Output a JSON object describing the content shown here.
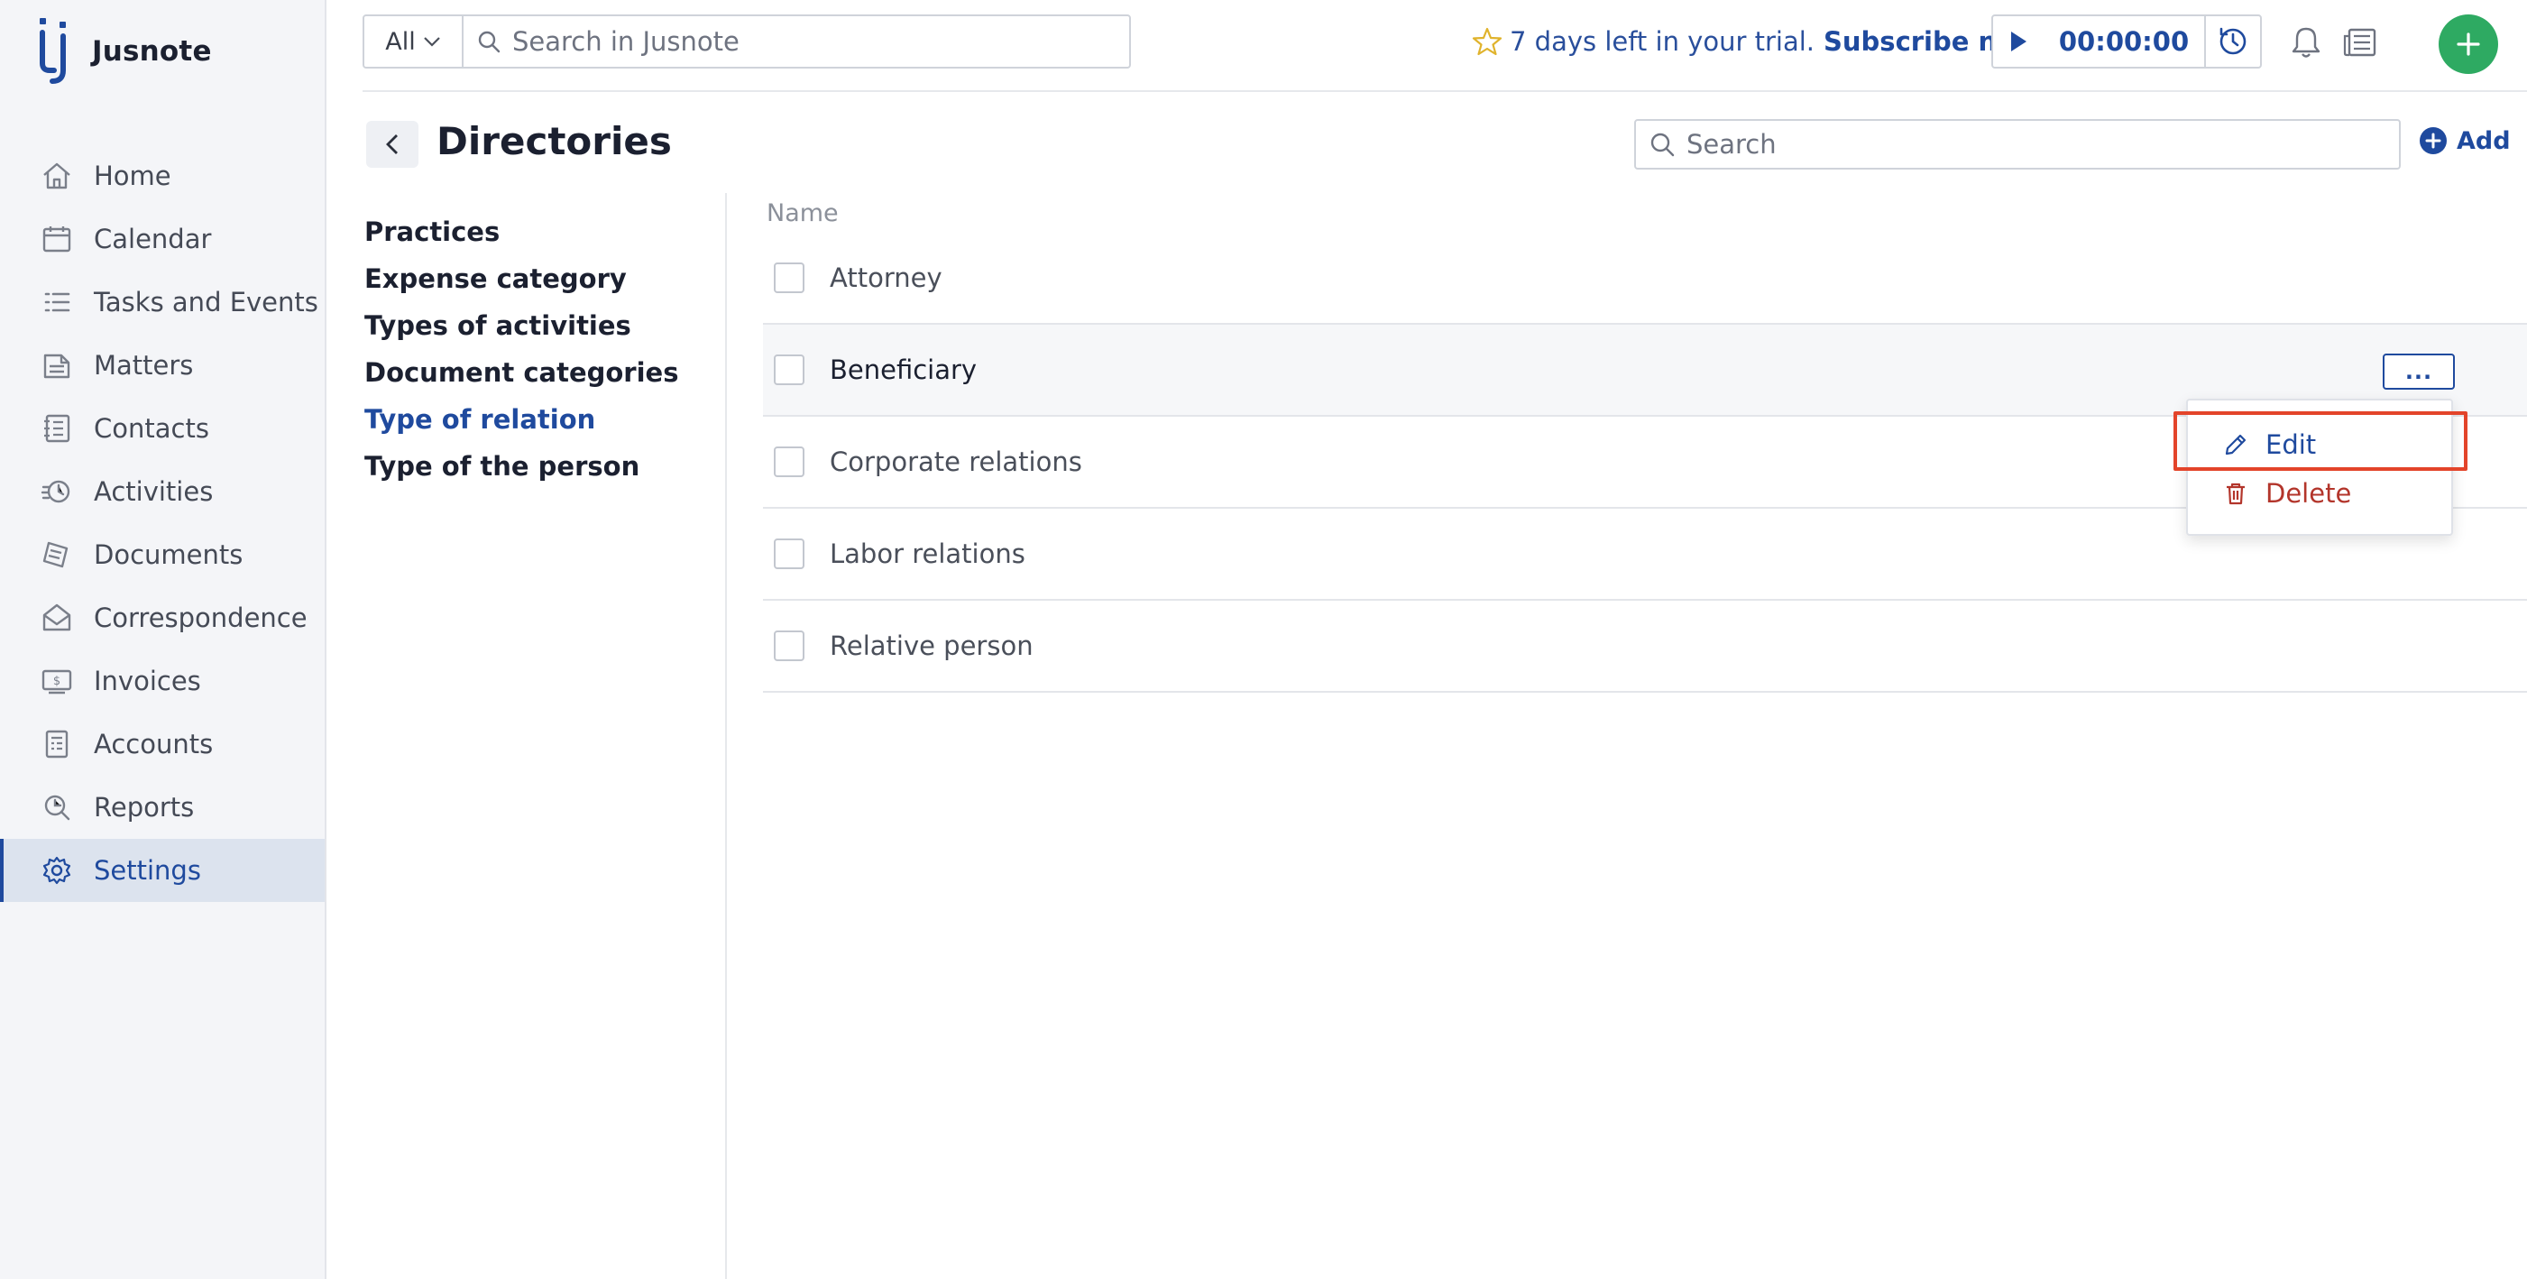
{
  "app": {
    "name": "Jusnote"
  },
  "sidebar": {
    "items": [
      {
        "label": "Home",
        "icon": "home-icon",
        "active": false
      },
      {
        "label": "Calendar",
        "icon": "calendar-icon",
        "active": false
      },
      {
        "label": "Tasks and Events",
        "icon": "tasks-icon",
        "active": false
      },
      {
        "label": "Matters",
        "icon": "matters-icon",
        "active": false
      },
      {
        "label": "Contacts",
        "icon": "contacts-icon",
        "active": false
      },
      {
        "label": "Activities",
        "icon": "activities-icon",
        "active": false
      },
      {
        "label": "Documents",
        "icon": "documents-icon",
        "active": false
      },
      {
        "label": "Correspondence",
        "icon": "correspondence-icon",
        "active": false
      },
      {
        "label": "Invoices",
        "icon": "invoices-icon",
        "active": false
      },
      {
        "label": "Accounts",
        "icon": "accounts-icon",
        "active": false
      },
      {
        "label": "Reports",
        "icon": "reports-icon",
        "active": false
      },
      {
        "label": "Settings",
        "icon": "gear-icon",
        "active": true
      }
    ]
  },
  "header": {
    "scope": "All",
    "search_placeholder": "Search in Jusnote",
    "trial_text": "7 days left in your trial.",
    "subscribe_label": "Subscribe now",
    "timer": "00:00:00"
  },
  "page": {
    "title": "Directories",
    "search_placeholder": "Search",
    "add_label": "Add"
  },
  "directories": [
    {
      "label": "Practices",
      "active": false
    },
    {
      "label": "Expense category",
      "active": false
    },
    {
      "label": "Types of activities",
      "active": false
    },
    {
      "label": "Document categories",
      "active": false
    },
    {
      "label": "Type of relation",
      "active": true
    },
    {
      "label": "Type of the person",
      "active": false
    }
  ],
  "table": {
    "column_name": "Name",
    "rows": [
      {
        "name": "Attorney"
      },
      {
        "name": "Beneficiary"
      },
      {
        "name": "Corporate relations"
      },
      {
        "name": "Labor relations"
      },
      {
        "name": "Relative person"
      }
    ],
    "more_label": "..."
  },
  "context_menu": {
    "edit_label": "Edit",
    "delete_label": "Delete"
  },
  "colors": {
    "accent": "#1f4a9e",
    "success": "#2eaa62",
    "danger": "#b3352b",
    "highlight": "#e3442a",
    "star": "#e0b32c"
  }
}
